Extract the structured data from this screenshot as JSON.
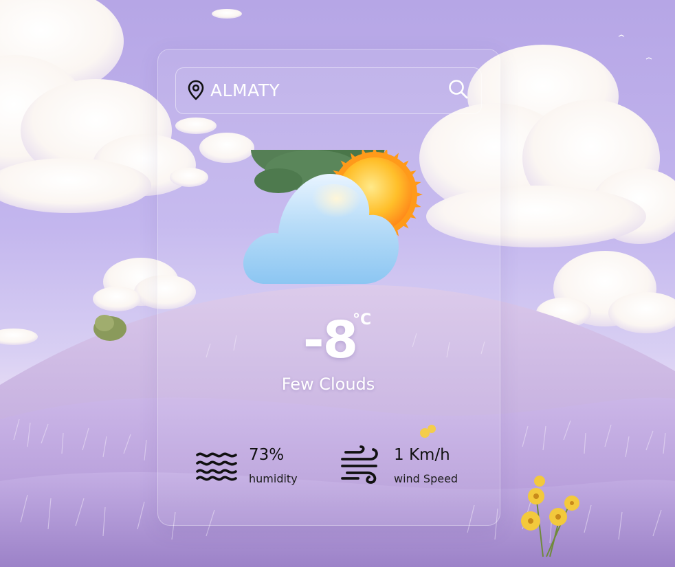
{
  "search": {
    "value": "ALMATY",
    "icon": "search-icon",
    "location_icon": "map-pin-icon"
  },
  "weather": {
    "icon": "partly-cloudy-icon",
    "temperature": "-8",
    "unit": "°C",
    "condition": "Few Clouds"
  },
  "details": {
    "humidity": {
      "icon": "waves-icon",
      "value": "73%",
      "label": "humidity"
    },
    "wind": {
      "icon": "wind-icon",
      "value": "1 Km/h",
      "label": "wind Speed"
    }
  },
  "colors": {
    "text_light": "#ffffff",
    "text_dark": "#111111",
    "sky": "#b6a6e6",
    "lavender": "#c9b3e6",
    "sun": "#ffb323",
    "cloud": "#a8d4f5"
  }
}
